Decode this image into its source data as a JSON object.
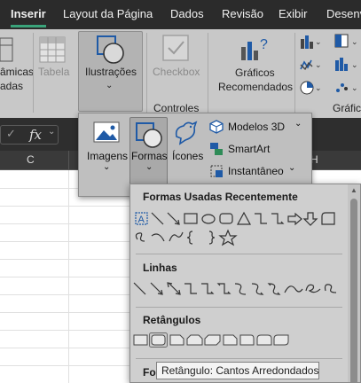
{
  "tabs": [
    {
      "label": "Inserir",
      "active": true
    },
    {
      "label": "Layout da Página"
    },
    {
      "label": "Dados"
    },
    {
      "label": "Revisão"
    },
    {
      "label": "Exibir"
    },
    {
      "label": "Desenv"
    }
  ],
  "ribbon": {
    "pivot_label_line1": "âmicas",
    "pivot_label_line2": "adas",
    "table_label": "Tabela",
    "illustrations_label": "Ilustrações",
    "checkbox_label": "Checkbox",
    "controls_group_label": "Controles",
    "recommended_charts_line1": "Gráficos",
    "recommended_charts_line2": "Recomendados",
    "charts_group_label_partial": "Gráfic"
  },
  "formula_bar": {
    "fx": "fx"
  },
  "sheet": {
    "column_c": "C",
    "column_h": "H"
  },
  "illustrations_menu": {
    "images_label": "Imagens",
    "shapes_label": "Formas",
    "icons_label": "Ícones",
    "models3d_label": "Modelos 3D",
    "smartart_label": "SmartArt",
    "screenshot_label": "Instantâneo"
  },
  "shapes_gallery": {
    "recent_title": "Formas Usadas Recentemente",
    "lines_title": "Linhas",
    "rectangles_title": "Retângulos",
    "next_title_partial": "For",
    "tooltip": "Retângulo: Cantos Arredondados"
  },
  "colors": {
    "accent": "#3aa37a",
    "ribbon_bg": "#c8c8c8",
    "titlebar_bg": "#2b2b2b",
    "icon_blue": "#1f5aa6"
  }
}
